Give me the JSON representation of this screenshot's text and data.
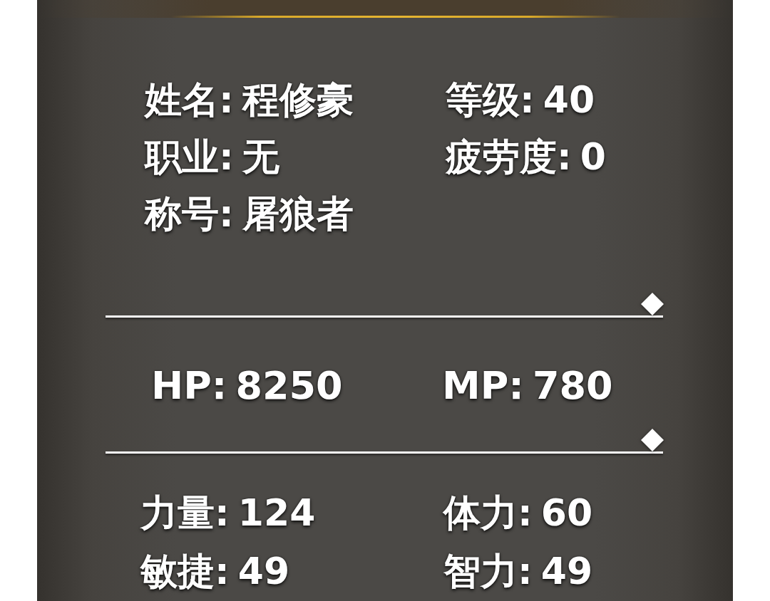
{
  "profile": {
    "fields": [
      {
        "label": "姓名:",
        "value": "程修豪"
      },
      {
        "label": "等级:",
        "value": "40"
      },
      {
        "label": "职业:",
        "value": "无"
      },
      {
        "label": "疲劳度:",
        "value": "0"
      },
      {
        "label": "称号:",
        "value": "屠狼者"
      }
    ]
  },
  "vitals": [
    {
      "label": "HP:",
      "value": "8250"
    },
    {
      "label": "MP:",
      "value": "780"
    }
  ],
  "attributes": [
    {
      "label": "力量:",
      "value": "124"
    },
    {
      "label": "体力:",
      "value": "60"
    },
    {
      "label": "敏捷:",
      "value": "49"
    },
    {
      "label": "智力:",
      "value": "49"
    }
  ]
}
